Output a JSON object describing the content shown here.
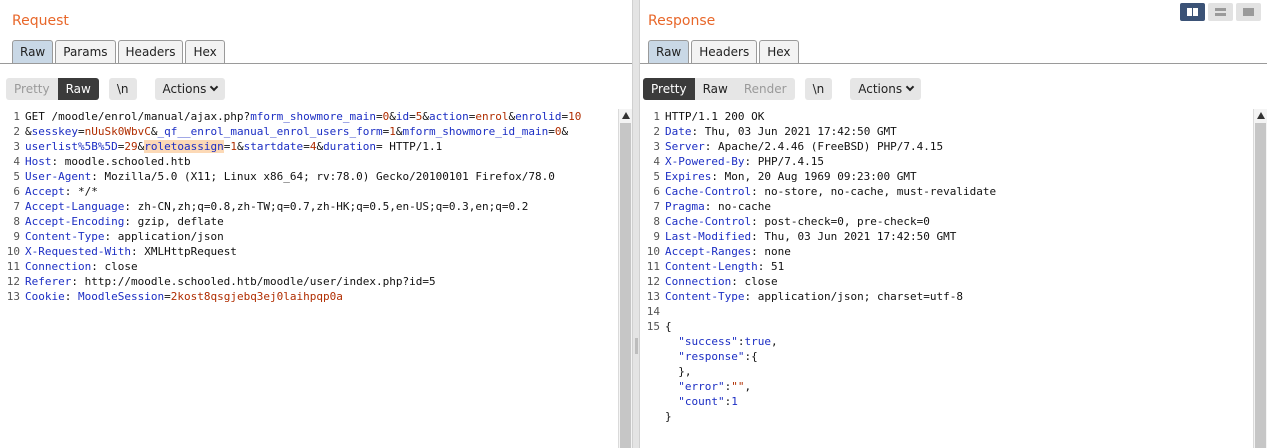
{
  "request": {
    "title": "Request",
    "tabs": [
      "Raw",
      "Params",
      "Headers",
      "Hex"
    ],
    "active_tab": "Raw",
    "view_pretty": "Pretty",
    "view_raw": "Raw",
    "newline": "\\n",
    "actions": "Actions",
    "line_numbers": [
      "1",
      "2",
      "3",
      "4",
      "5",
      "6",
      "7",
      "8",
      "9",
      "10",
      "11",
      "12",
      "13"
    ],
    "request_line": {
      "method": "GET",
      "path": "/moodle/enrol/manual/ajax.php?",
      "line1_params": [
        {
          "k": "mform_showmore_main",
          "v": "0"
        },
        {
          "k": "id",
          "v": "5"
        },
        {
          "k": "action",
          "v": "enrol"
        },
        {
          "k": "enrolid",
          "v": "10"
        }
      ],
      "line2_params": [
        {
          "k": "sesskey",
          "v": "nUuSk0WbvC"
        },
        {
          "k": "_qf__enrol_manual_enrol_users_form",
          "v": "1"
        },
        {
          "k": "mform_showmore_id_main",
          "v": "0"
        }
      ],
      "line3_params": [
        {
          "k": "userlist%5B%5D",
          "v": "29"
        },
        {
          "k": "roletoassign",
          "v": "1"
        },
        {
          "k": "startdate",
          "v": "4"
        },
        {
          "k": "duration",
          "v": ""
        }
      ],
      "version": "HTTP/1.1"
    },
    "headers": [
      {
        "name": "Host",
        "value": "moodle.schooled.htb"
      },
      {
        "name": "User-Agent",
        "value": "Mozilla/5.0 (X11; Linux x86_64; rv:78.0) Gecko/20100101 Firefox/78.0"
      },
      {
        "name": "Accept",
        "value": "*/*"
      },
      {
        "name": "Accept-Language",
        "value": "zh-CN,zh;q=0.8,zh-TW;q=0.7,zh-HK;q=0.5,en-US;q=0.3,en;q=0.2"
      },
      {
        "name": "Accept-Encoding",
        "value": "gzip, deflate"
      },
      {
        "name": "Content-Type",
        "value": "application/json"
      },
      {
        "name": "X-Requested-With",
        "value": "XMLHttpRequest"
      },
      {
        "name": "Connection",
        "value": "close"
      },
      {
        "name": "Referer",
        "value": "http://moodle.schooled.htb/moodle/user/index.php?id=5"
      }
    ],
    "cookie": {
      "name": "Cookie",
      "key": "MoodleSession",
      "value": "2kost8qsgjebq3ej0laihpqp0a"
    }
  },
  "response": {
    "title": "Response",
    "tabs": [
      "Raw",
      "Headers",
      "Hex"
    ],
    "active_tab": "Raw",
    "view_pretty": "Pretty",
    "view_raw": "Raw",
    "view_render": "Render",
    "newline": "\\n",
    "actions": "Actions",
    "line_numbers": [
      "1",
      "2",
      "3",
      "4",
      "5",
      "6",
      "7",
      "8",
      "9",
      "10",
      "11",
      "12",
      "13",
      "14",
      "15"
    ],
    "status_line": "HTTP/1.1 200 OK",
    "headers": [
      {
        "name": "Date",
        "value": "Thu, 03 Jun 2021 17:42:50 GMT"
      },
      {
        "name": "Server",
        "value": "Apache/2.4.46 (FreeBSD) PHP/7.4.15"
      },
      {
        "name": "X-Powered-By",
        "value": "PHP/7.4.15"
      },
      {
        "name": "Expires",
        "value": "Mon, 20 Aug 1969 09:23:00 GMT"
      },
      {
        "name": "Cache-Control",
        "value": "no-store, no-cache, must-revalidate"
      },
      {
        "name": "Pragma",
        "value": "no-cache"
      },
      {
        "name": "Cache-Control",
        "value": "post-check=0, pre-check=0"
      },
      {
        "name": "Last-Modified",
        "value": "Thu, 03 Jun 2021 17:42:50 GMT"
      },
      {
        "name": "Accept-Ranges",
        "value": "none"
      },
      {
        "name": "Content-Length",
        "value": "51"
      },
      {
        "name": "Connection",
        "value": "close"
      },
      {
        "name": "Content-Type",
        "value": "application/json; charset=utf-8"
      }
    ],
    "body_lines": [
      "{",
      "  \"success\":true,",
      "  \"response\":{",
      "  },",
      "  \"error\":\"\",",
      "  \"count\":1",
      "}"
    ]
  },
  "layout_icons": [
    "split-horizontal-icon",
    "split-vertical-icon",
    "tabs-icon"
  ]
}
